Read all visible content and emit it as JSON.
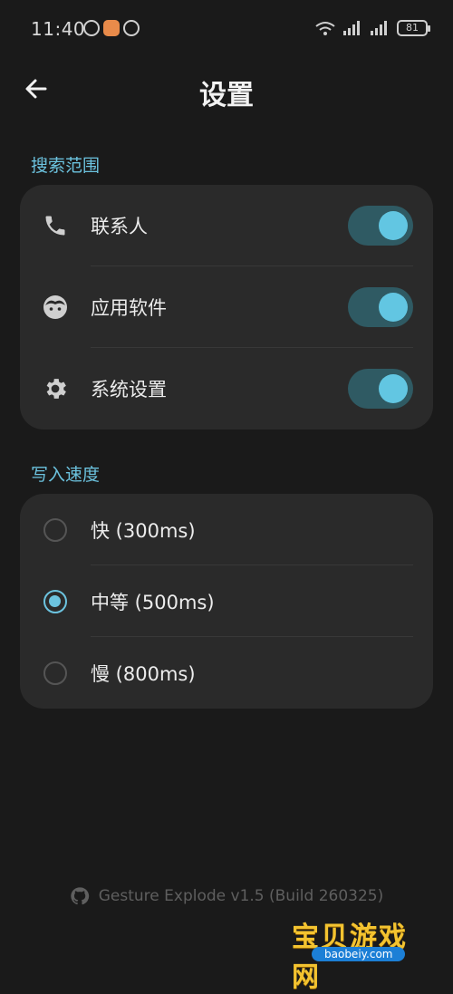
{
  "status_bar": {
    "time": "11:40",
    "battery_label": "81"
  },
  "header": {
    "title": "设置",
    "back_icon": "arrow-left-icon"
  },
  "search_section": {
    "label": "搜索范围",
    "items": [
      {
        "label": "联系人",
        "icon": "phone-icon",
        "enabled": true
      },
      {
        "label": "应用软件",
        "icon": "face-icon",
        "enabled": true
      },
      {
        "label": "系统设置",
        "icon": "gear-icon",
        "enabled": true
      }
    ]
  },
  "speed_section": {
    "label": "写入速度",
    "options": [
      {
        "label": "快 (300ms)",
        "selected": false
      },
      {
        "label": "中等 (500ms)",
        "selected": true
      },
      {
        "label": "慢 (800ms)",
        "selected": false
      }
    ]
  },
  "footer": {
    "text": "Gesture Explode v1.5 (Build 260325)",
    "icon": "github-icon"
  },
  "watermark": {
    "title": "宝贝游戏网",
    "domain": "baobeiy.com"
  },
  "colors": {
    "accent": "#6cc3df",
    "toggle_track": "#2f5a63",
    "card_bg": "#2a2a2a",
    "page_bg": "#1a1a1a"
  }
}
